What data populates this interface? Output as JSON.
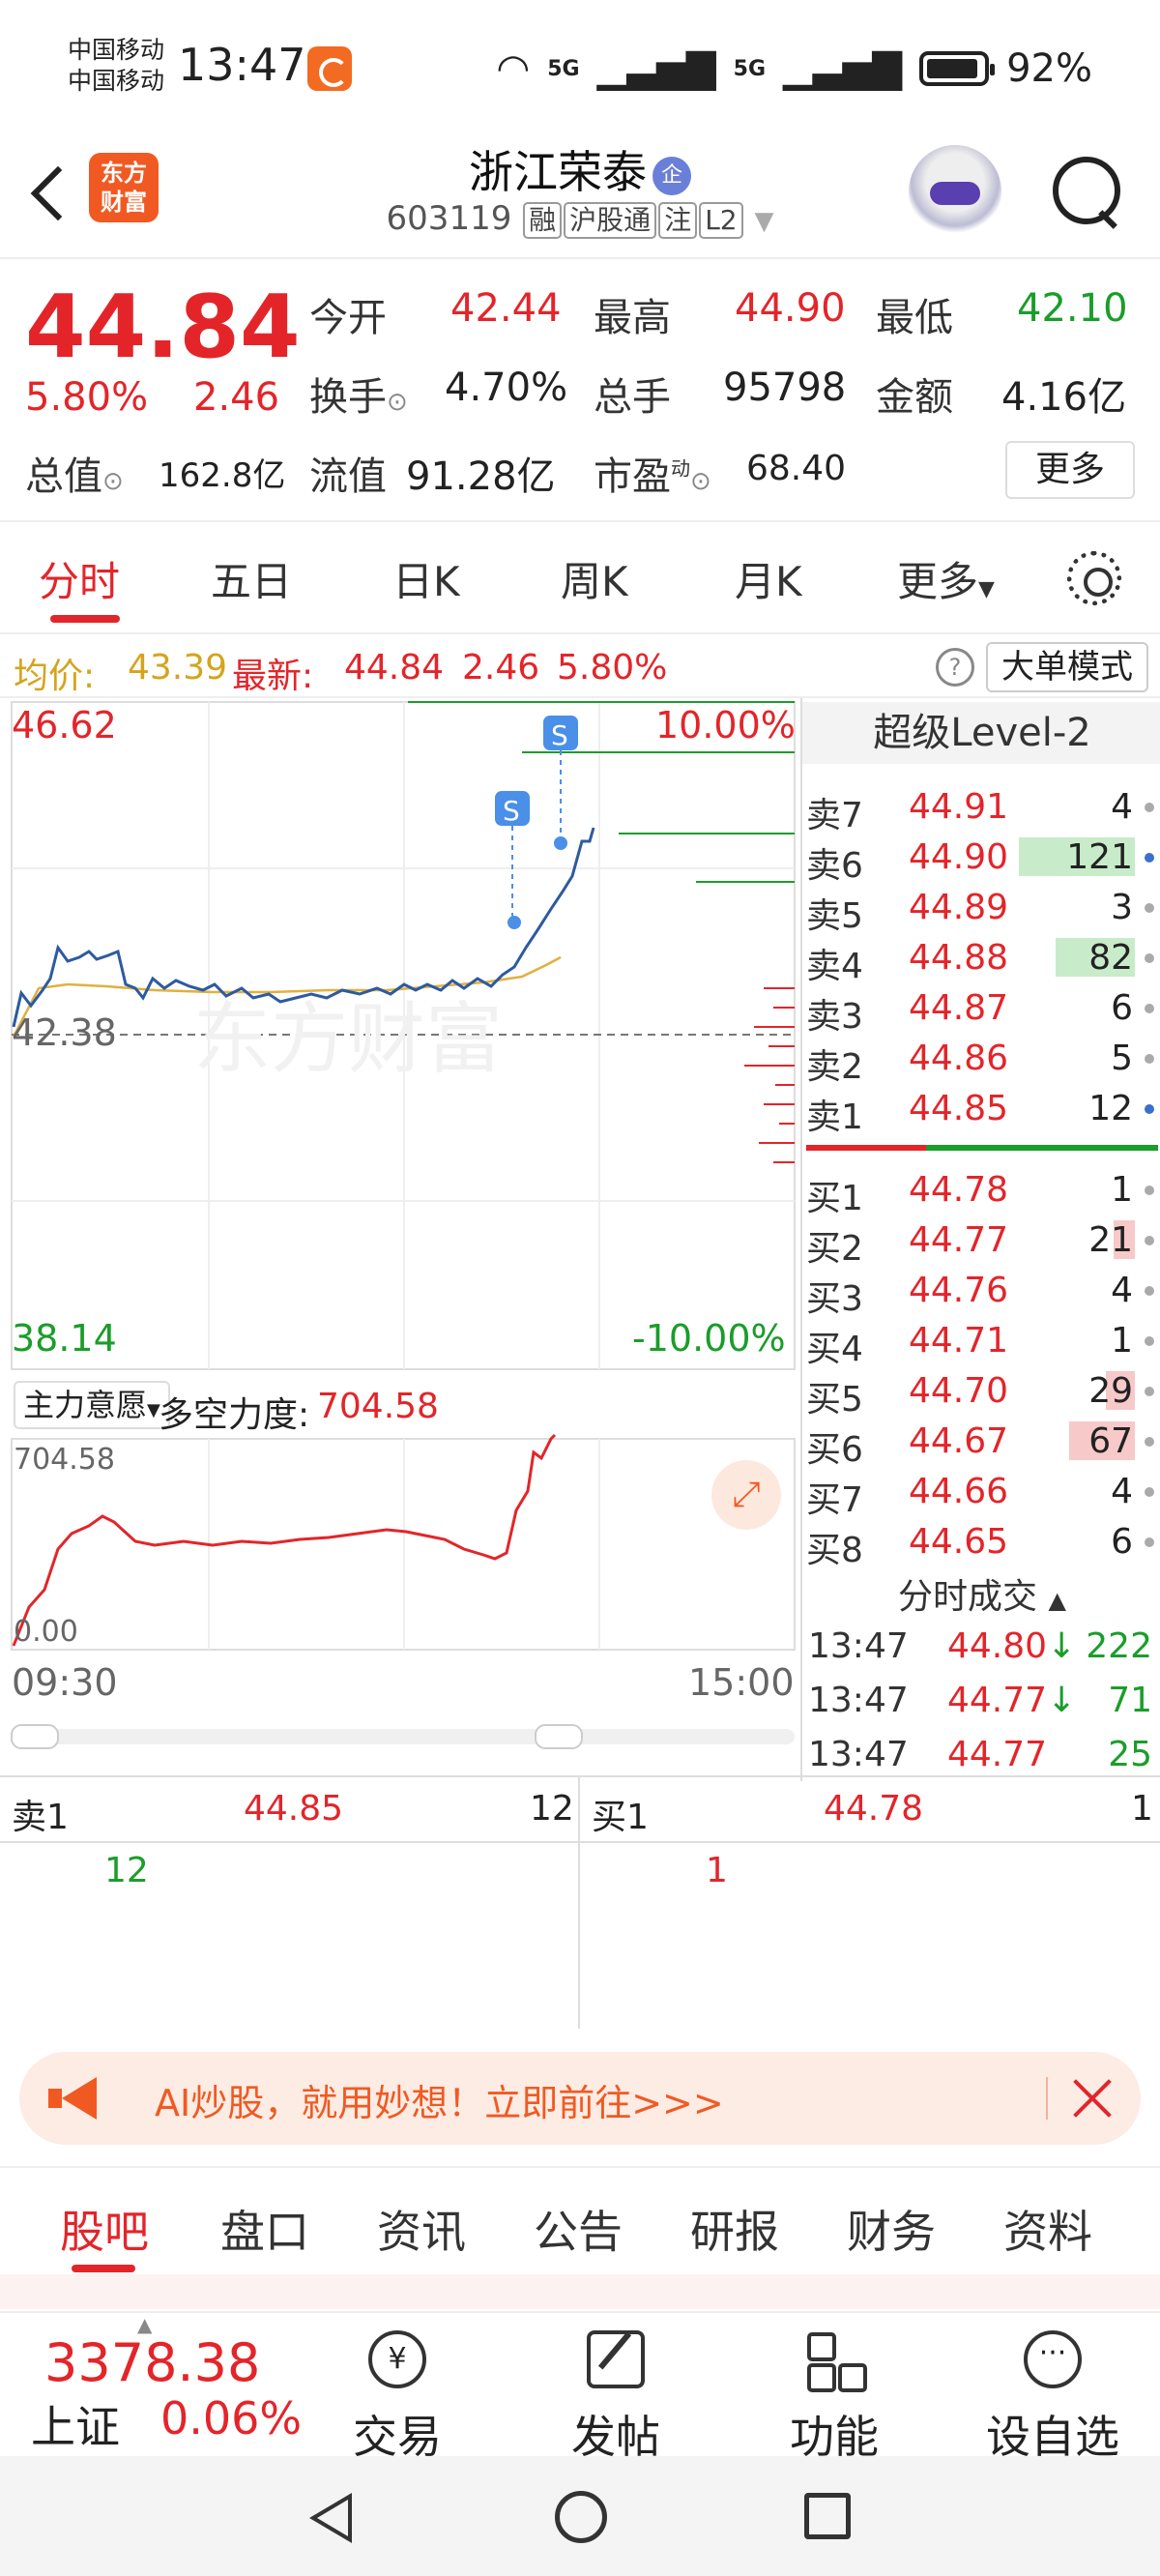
{
  "status_bar": {
    "carrier_1": "中国移动",
    "carrier_2": "中国移动",
    "time": "13:47",
    "sig1": "5G",
    "sig2": "5G",
    "battery": "92%"
  },
  "header": {
    "logo_line1": "东方",
    "logo_line2": "财富",
    "stock_name": "浙江荣泰",
    "cert_badge": "企",
    "code": "603119",
    "tags": [
      "融",
      "沪股通",
      "注",
      "L2"
    ]
  },
  "quote": {
    "price": "44.84",
    "pct": "5.80%",
    "change": "2.46",
    "open_label": "今开",
    "open": "42.44",
    "high_label": "最高",
    "high": "44.90",
    "low_label": "最低",
    "low": "42.10",
    "turnover_label": "换手",
    "turnover": "4.70%",
    "volume_label": "总手",
    "volume": "95798",
    "amount_label": "金额",
    "amount": "4.16亿",
    "mcap_label": "总值",
    "mcap": "162.8亿",
    "float_label": "流值",
    "float": "91.28亿",
    "pe_label": "市盈",
    "pe_sup": "动",
    "pe": "68.40",
    "more": "更多"
  },
  "chart_tabs": [
    "分时",
    "五日",
    "日K",
    "周K",
    "月K",
    "更多"
  ],
  "avg_bar": {
    "avg_label": "均价:",
    "avg": "43.39",
    "latest_label": "最新:",
    "latest": "44.84",
    "change": "2.46",
    "pct": "5.80%",
    "bigorder": "大单模式"
  },
  "chart": {
    "y_max": "46.62",
    "y_min": "38.14",
    "y_ref": "42.38",
    "pct_max": "10.00%",
    "pct_min": "-10.00%",
    "watermark": "东方财富",
    "marker": "S",
    "sub_selector": "主力意愿",
    "sub_label": "多空力度:",
    "sub_value": "704.58",
    "sub_max": "704.58",
    "sub_min": "0.00",
    "t_start": "09:30",
    "t_end": "15:00"
  },
  "level2": {
    "title": "超级Level-2",
    "asks": [
      {
        "label": "卖7",
        "price": "44.91",
        "vol": "4"
      },
      {
        "label": "卖6",
        "price": "44.90",
        "vol": "121"
      },
      {
        "label": "卖5",
        "price": "44.89",
        "vol": "3"
      },
      {
        "label": "卖4",
        "price": "44.88",
        "vol": "82"
      },
      {
        "label": "卖3",
        "price": "44.87",
        "vol": "6"
      },
      {
        "label": "卖2",
        "price": "44.86",
        "vol": "5"
      },
      {
        "label": "卖1",
        "price": "44.85",
        "vol": "12"
      }
    ],
    "bids": [
      {
        "label": "买1",
        "price": "44.78",
        "vol": "1"
      },
      {
        "label": "买2",
        "price": "44.77",
        "vol": "21"
      },
      {
        "label": "买3",
        "price": "44.76",
        "vol": "4"
      },
      {
        "label": "买4",
        "price": "44.71",
        "vol": "1"
      },
      {
        "label": "买5",
        "price": "44.70",
        "vol": "29"
      },
      {
        "label": "买6",
        "price": "44.67",
        "vol": "67"
      },
      {
        "label": "买7",
        "price": "44.66",
        "vol": "4"
      },
      {
        "label": "买8",
        "price": "44.65",
        "vol": "6"
      }
    ],
    "trades_title": "分时成交",
    "trades": [
      {
        "time": "13:47",
        "price": "44.80",
        "vol": "222",
        "arrow": "↓"
      },
      {
        "time": "13:47",
        "price": "44.77",
        "vol": "71",
        "arrow": "↓"
      },
      {
        "time": "13:47",
        "price": "44.77",
        "vol": "25",
        "arrow": ""
      }
    ]
  },
  "order_table": {
    "ask_label": "卖1",
    "ask_price": "44.85",
    "ask_vol": "12",
    "ask_detail": "12",
    "bid_label": "买1",
    "bid_price": "44.78",
    "bid_vol": "1",
    "bid_detail": "1"
  },
  "ai_banner": {
    "text": "AI炒股，就用妙想！立即前往>>>"
  },
  "info_tabs": [
    "股吧",
    "盘口",
    "资讯",
    "公告",
    "研报",
    "财务",
    "资料"
  ],
  "bottom_bar": {
    "index_value": "3378.38",
    "index_name": "上证",
    "index_change": "0.06%",
    "buttons": [
      "交易",
      "发帖",
      "功能",
      "设自选"
    ],
    "trade_glyph": "¥"
  },
  "colors": {
    "up": "#e3252a",
    "down": "#1b9d2a",
    "price_line": "#2d5aa0",
    "avg_line": "#e0b040"
  }
}
